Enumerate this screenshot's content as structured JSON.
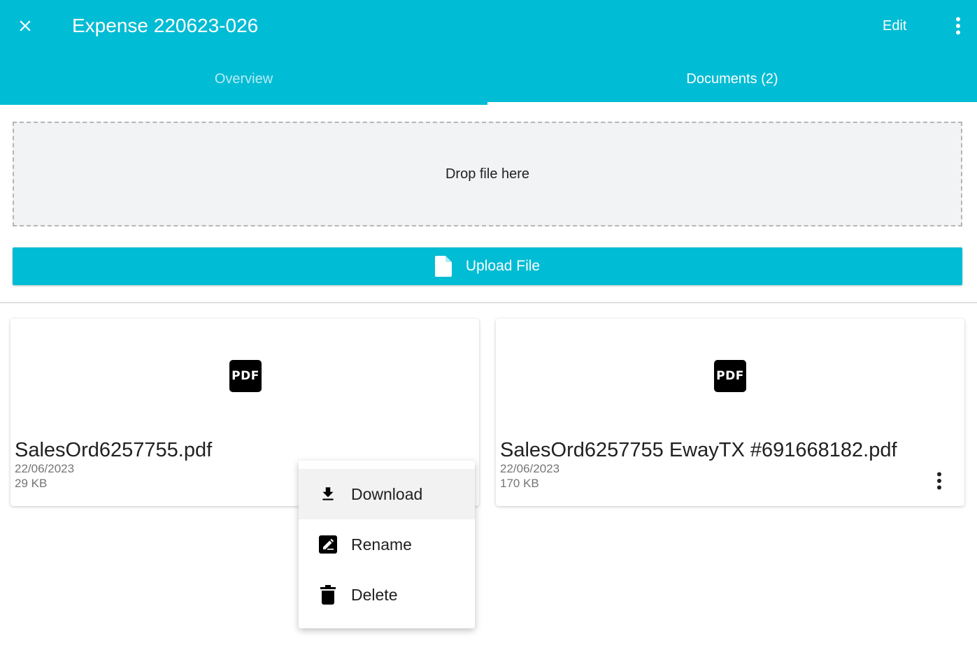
{
  "header": {
    "title": "Expense 220623-026",
    "edit_label": "Edit",
    "close_icon": "close-icon",
    "more_icon": "more-vert-icon",
    "background_color": "#00BCD4"
  },
  "tabs": [
    {
      "label": "Overview",
      "selected": false
    },
    {
      "label": "Documents (2)",
      "selected": true
    }
  ],
  "dropzone": {
    "label": "Drop file here"
  },
  "upload": {
    "label": "Upload File",
    "icon": "file-icon"
  },
  "documents": [
    {
      "badge": "PDF",
      "name": "SalesOrd6257755.pdf",
      "date": "22/06/2023",
      "size": "29 KB"
    },
    {
      "badge": "PDF",
      "name": "SalesOrd6257755 EwayTX #691668182.pdf",
      "date": "22/06/2023",
      "size": "170 KB"
    }
  ],
  "context_menu": {
    "items": [
      {
        "label": "Download",
        "icon": "download-icon",
        "highlighted": true
      },
      {
        "label": "Rename",
        "icon": "edit-icon",
        "highlighted": false
      },
      {
        "label": "Delete",
        "icon": "delete-icon",
        "highlighted": false
      }
    ]
  }
}
